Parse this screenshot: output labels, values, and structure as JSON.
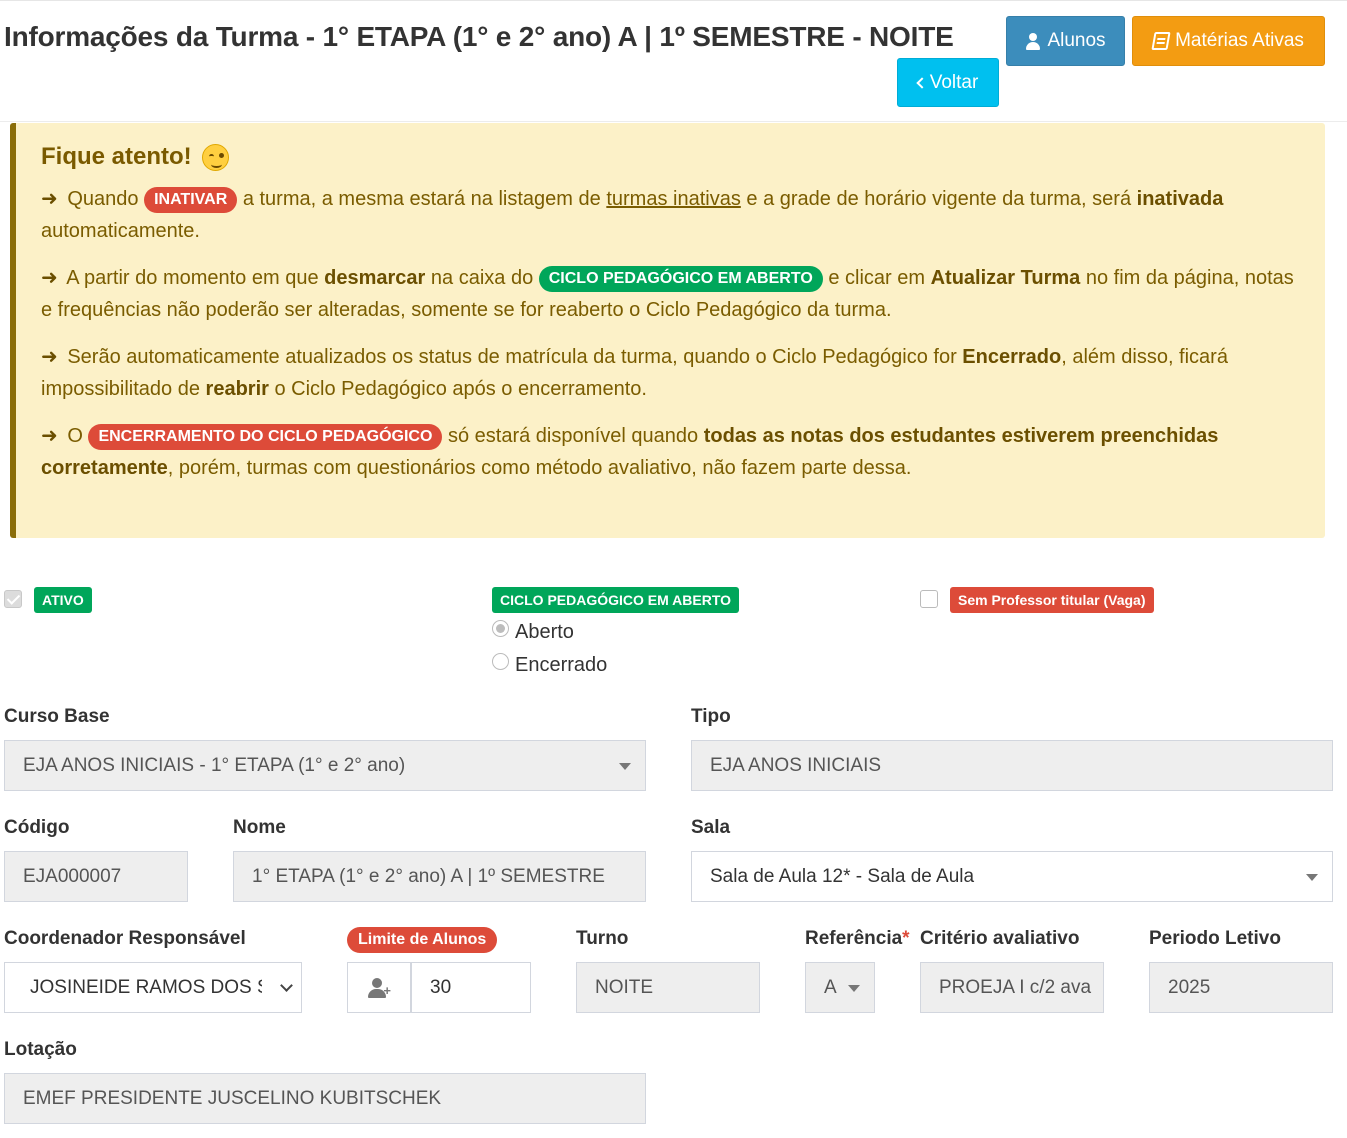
{
  "header": {
    "title": "Informações da Turma - 1° ETAPA (1° e 2° ano) A | 1º SEMESTRE - NOITE",
    "buttons": {
      "alunos": "Alunos",
      "materias": "Matérias Ativas",
      "voltar": "Voltar"
    }
  },
  "callout": {
    "title": "Fique atento!",
    "arrow": "➜",
    "p1": {
      "a": "Quando",
      "badge": "INATIVAR",
      "b": "a turma, a mesma estará na listagem de",
      "link": "turmas inativas",
      "c": "e a grade de horário vigente da turma, será",
      "bold": "inativada",
      "d": "automaticamente."
    },
    "p2": {
      "a": "A partir do momento em que",
      "bold1": "desmarcar",
      "b": "na caixa do",
      "badge": "CICLO PEDAGÓGICO EM ABERTO",
      "c": "e clicar em",
      "bold2": "Atualizar Turma",
      "d": "no fim da página, notas e frequências não poderão ser alteradas, somente se for reaberto o Ciclo Pedagógico da turma."
    },
    "p3": {
      "a": "Serão automaticamente atualizados os status de matrícula da turma, quando o Ciclo Pedagógico for",
      "bold1": "Encerrado",
      "b": ", além disso, ficará impossibilitado de",
      "bold2": "reabrir",
      "c": "o Ciclo Pedagógico após o encerramento."
    },
    "p4": {
      "a": "O",
      "badge": "ENCERRAMENTO DO CICLO PEDAGÓGICO",
      "b": "só estará disponível quando",
      "bold": "todas as notas dos estudantes estiverem preenchidas corretamente",
      "c": ", porém, turmas com questionários como método avaliativo, não fazem parte dessa."
    }
  },
  "status": {
    "ativo_label": "ATIVO",
    "ativo_checked": true,
    "ciclo_label": "CICLO PEDAGÓGICO EM ABERTO",
    "ciclo_options": [
      "Aberto",
      "Encerrado"
    ],
    "ciclo_selected": "Aberto",
    "sem_professor_label": "Sem Professor titular (Vaga)",
    "sem_professor_checked": false
  },
  "form": {
    "curso_base": {
      "label": "Curso Base",
      "value": "EJA ANOS INICIAIS - 1° ETAPA (1° e 2° ano)"
    },
    "tipo": {
      "label": "Tipo",
      "value": "EJA ANOS INICIAIS"
    },
    "codigo": {
      "label": "Código",
      "value": "EJA000007"
    },
    "nome": {
      "label": "Nome",
      "value": "1° ETAPA (1° e 2° ano) A | 1º SEMESTRE"
    },
    "sala": {
      "label": "Sala",
      "value": "Sala de Aula 12* - Sala de Aula"
    },
    "coordenador": {
      "label": "Coordenador Responsável",
      "value": "JOSINEIDE RAMOS DOS S ("
    },
    "limite": {
      "label": "Limite de Alunos",
      "value": "30"
    },
    "turno": {
      "label": "Turno",
      "value": "NOITE"
    },
    "referencia": {
      "label": "Referência",
      "required": "*",
      "value": "A"
    },
    "criterio": {
      "label": "Critério avaliativo",
      "value": "PROEJA I c/2 ava"
    },
    "periodo": {
      "label": "Periodo Letivo",
      "value": "2025"
    },
    "lotacao": {
      "label": "Lotação",
      "value": "EMEF PRESIDENTE JUSCELINO KUBITSCHEK"
    }
  }
}
